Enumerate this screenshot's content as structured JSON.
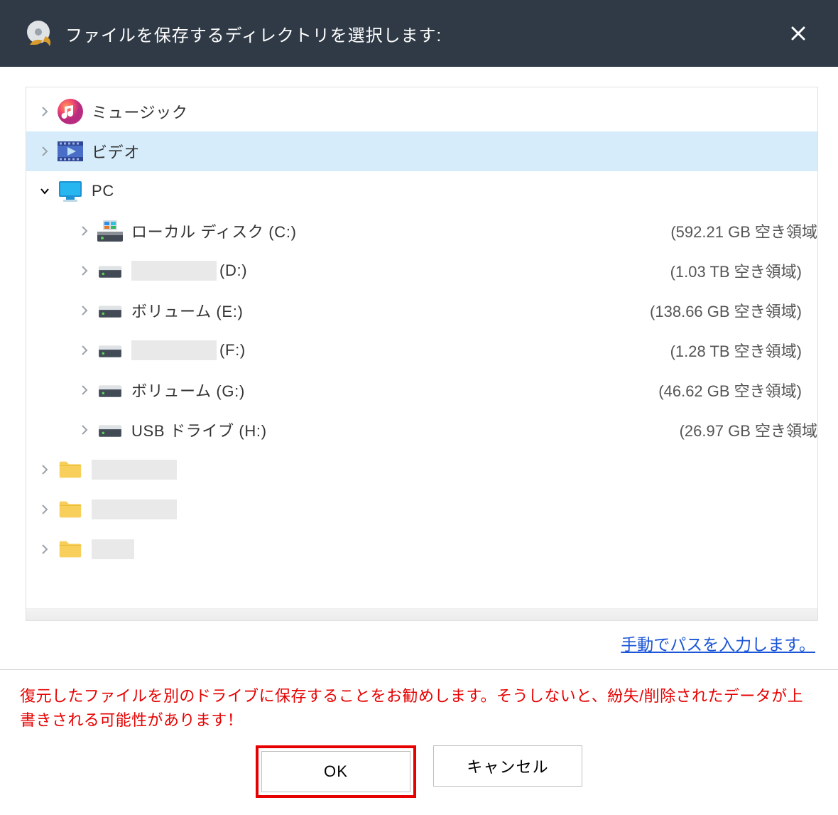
{
  "header": {
    "title": "ファイルを保存するディレクトリを選択します:"
  },
  "tree": {
    "music_label": "ミュージック",
    "video_label": "ビデオ",
    "pc_label": "PC",
    "drives": [
      {
        "label": "ローカル ディスク (C:)",
        "size": "(592.21 GB 空き領域",
        "system": true,
        "masked": false,
        "truncated": true
      },
      {
        "label_prefix": "",
        "suffix": " (D:)",
        "size": "(1.03 TB 空き領域)",
        "system": false,
        "masked": true
      },
      {
        "label": "ボリューム (E:)",
        "size": "(138.66 GB 空き領域)",
        "system": false,
        "masked": false
      },
      {
        "label_prefix": "",
        "suffix": " (F:)",
        "size": "(1.28 TB 空き領域)",
        "system": false,
        "masked": true
      },
      {
        "label": "ボリューム (G:)",
        "size": "(46.62 GB 空き領域)",
        "system": false,
        "masked": false
      },
      {
        "label": "USB ドライブ (H:)",
        "size": "(26.97 GB 空き領域",
        "system": false,
        "masked": false,
        "truncated": true
      }
    ]
  },
  "manual_path_link": "手動でパスを入力します。",
  "warning_text": "復元したファイルを別のドライブに保存することをお勧めします。そうしないと、紛失/削除されたデータが上書きされる可能性があります！",
  "buttons": {
    "ok": "OK",
    "cancel": "キャンセル"
  }
}
